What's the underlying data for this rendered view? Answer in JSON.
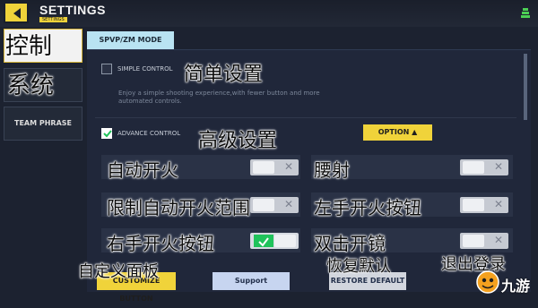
{
  "header": {
    "title": "SETTINGS",
    "subtitle": "SETTINGS"
  },
  "sidebar": {
    "items": [
      {
        "overlay": "控制"
      },
      {
        "overlay": "系统"
      },
      {
        "label": "TEAM PHRASE"
      }
    ]
  },
  "main": {
    "mode_tab": "SPVP/ZM MODE",
    "simple": {
      "label": "SIMPLE CONTROL",
      "overlay": "简单设置",
      "description": "Enjoy a simple shooting experience,with fewer button and more automated controls."
    },
    "advance": {
      "label": "ADVANCE CONTROL",
      "overlay": "高级设置",
      "option_button": "OPTION ▲"
    },
    "settings": [
      {
        "label": "自动开火",
        "enabled": false
      },
      {
        "label": "腰射",
        "enabled": false
      },
      {
        "label": "限制自动开火范围",
        "enabled": false
      },
      {
        "label": "左手开火按钮",
        "enabled": false
      },
      {
        "label": "右手开火按钮",
        "enabled": true
      },
      {
        "label": "双击开镜",
        "enabled": false
      }
    ]
  },
  "footer": {
    "customize_button": "CUSTOMIZE BUTTON",
    "support_button": "Support",
    "restore_button": "RESTORE DEFAULT",
    "overlay_customize": "自定义面板",
    "overlay_restore": "恢复默认",
    "overlay_logout": "退出登录"
  },
  "watermark": {
    "text": "九游"
  },
  "colors": {
    "accent": "#f0d33a",
    "background": "#1c2230",
    "row": "#2a3246",
    "toggle_on": "#20c35b"
  },
  "icons": {
    "back": "back-arrow-icon",
    "status": "wifi-icon",
    "check": "check-icon",
    "close": "x-icon"
  }
}
